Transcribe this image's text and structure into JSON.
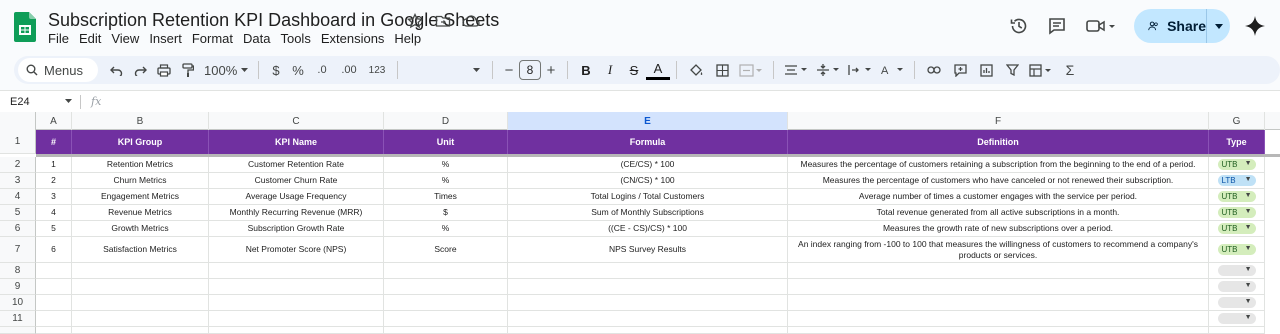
{
  "document": {
    "title": "Subscription Retention KPI Dashboard in Google Sheets",
    "menu": [
      "File",
      "Edit",
      "View",
      "Insert",
      "Format",
      "Data",
      "Tools",
      "Extensions",
      "Help"
    ],
    "share_label": "Share"
  },
  "toolbar": {
    "search_label": "Menus",
    "zoom": "100%",
    "currency": "$",
    "percent": "%",
    "dec_decrease": ".0",
    "dec_increase": ".00",
    "number_format": "123",
    "font_size": "8",
    "minus": "−",
    "plus": "+",
    "bold": "B",
    "italic": "I",
    "strike": "S",
    "text_color": "A"
  },
  "formula_bar": {
    "cell_ref": "E24",
    "fx": "fx"
  },
  "columns": [
    "A",
    "B",
    "C",
    "D",
    "E",
    "F",
    "G"
  ],
  "selected_column": "E",
  "header_row": {
    "row_number": "1",
    "cells": [
      "#",
      "KPI Group",
      "KPI Name",
      "Unit",
      "Formula",
      "Definition",
      "Type"
    ]
  },
  "rows": [
    {
      "row_number": "2",
      "num": "1",
      "group": "Retention Metrics",
      "name": "Customer Retention Rate",
      "unit": "%",
      "formula": "(CE/CS) * 100",
      "definition": "Measures the percentage of customers retaining a subscription from the beginning to the end of a period.",
      "type": "UTB"
    },
    {
      "row_number": "3",
      "num": "2",
      "group": "Churn Metrics",
      "name": "Customer Churn Rate",
      "unit": "%",
      "formula": "(CN/CS) * 100",
      "definition": "Measures the percentage of customers who have canceled or not renewed their subscription.",
      "type": "LTB"
    },
    {
      "row_number": "4",
      "num": "3",
      "group": "Engagement Metrics",
      "name": "Average Usage Frequency",
      "unit": "Times",
      "formula": "Total Logins / Total Customers",
      "definition": "Average number of times a customer engages with the service per period.",
      "type": "UTB"
    },
    {
      "row_number": "5",
      "num": "4",
      "group": "Revenue Metrics",
      "name": "Monthly Recurring Revenue (MRR)",
      "unit": "$",
      "formula": "Sum of Monthly Subscriptions",
      "definition": "Total revenue generated from all active subscriptions in a month.",
      "type": "UTB"
    },
    {
      "row_number": "6",
      "num": "5",
      "group": "Growth Metrics",
      "name": "Subscription Growth Rate",
      "unit": "%",
      "formula": "((CE - CS)/CS) * 100",
      "definition": "Measures the growth rate of new subscriptions over a period.",
      "type": "UTB"
    },
    {
      "row_number": "7",
      "num": "6",
      "group": "Satisfaction Metrics",
      "name": "Net Promoter Score (NPS)",
      "unit": "Score",
      "formula": "NPS Survey Results",
      "definition": "An index ranging from -100 to 100 that measures the willingness of customers to recommend a company's products or services.",
      "type": "UTB"
    }
  ],
  "empty_rows": [
    "8",
    "9",
    "10",
    "11"
  ],
  "colors": {
    "header_fill": "#7030a0",
    "utb_chip": "#d4edbc",
    "ltb_chip": "#bfe1f6",
    "share_button": "#c2e7ff"
  }
}
